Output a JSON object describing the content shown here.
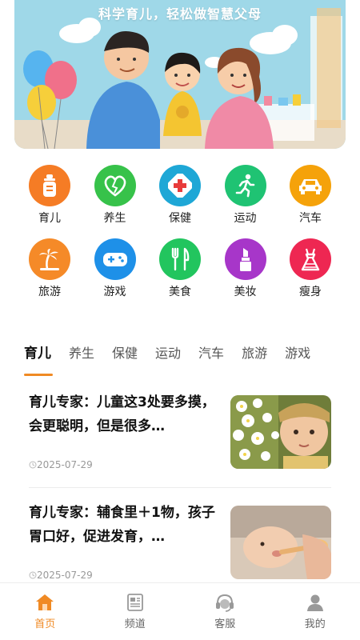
{
  "banner": {
    "slogan": "科学育儿，轻松做智慧父母"
  },
  "categories": [
    {
      "label": "育儿",
      "color": "#f57c25",
      "icon": "baby-bottle-icon"
    },
    {
      "label": "养生",
      "color": "#37c24a",
      "icon": "heart-leaf-icon"
    },
    {
      "label": "保健",
      "color": "#1ea7d6",
      "icon": "medical-cross-icon"
    },
    {
      "label": "运动",
      "color": "#1fc373",
      "icon": "running-icon"
    },
    {
      "label": "汽车",
      "color": "#f5a20a",
      "icon": "car-icon"
    },
    {
      "label": "旅游",
      "color": "#f58a28",
      "icon": "palm-tree-icon"
    },
    {
      "label": "游戏",
      "color": "#1e90e8",
      "icon": "gamepad-icon"
    },
    {
      "label": "美食",
      "color": "#22c55e",
      "icon": "cutlery-icon"
    },
    {
      "label": "美妆",
      "color": "#a736c9",
      "icon": "lipstick-icon"
    },
    {
      "label": "瘦身",
      "color": "#ee2752",
      "icon": "dress-icon"
    }
  ],
  "tabs": [
    "育儿",
    "养生",
    "保健",
    "运动",
    "汽车",
    "旅游",
    "游戏"
  ],
  "active_tab": "育儿",
  "articles": [
    {
      "title": "育儿专家：儿童这3处要多摸，会更聪明，但是很多…",
      "date": "2025-07-29"
    },
    {
      "title": "育儿专家：辅食里＋1物，孩子胃口好，促进发育，…",
      "date": "2025-07-29"
    }
  ],
  "nav": [
    {
      "label": "首页",
      "active": true
    },
    {
      "label": "频道",
      "active": false
    },
    {
      "label": "客服",
      "active": false
    },
    {
      "label": "我的",
      "active": false
    }
  ],
  "colors": {
    "accent": "#f08a24",
    "inactive": "#999999"
  }
}
